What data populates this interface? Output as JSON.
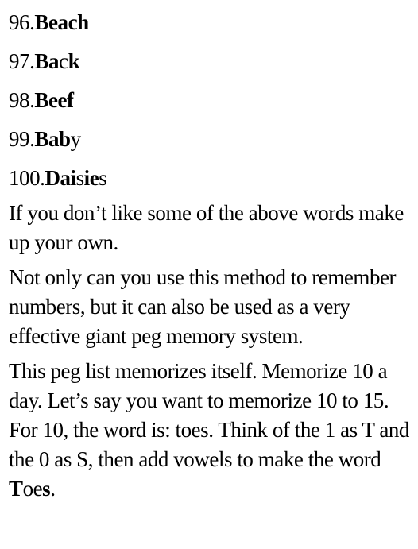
{
  "list": [
    {
      "number": "96.",
      "bold": "Bea",
      "plain": "",
      "bold2": "ch",
      "plain2": ""
    },
    {
      "number": "97.",
      "bold": "Ba",
      "plain": "c",
      "bold2": "k",
      "plain2": ""
    },
    {
      "number": "98.",
      "bold": "Bee",
      "plain": "",
      "bold2": "f",
      "plain2": ""
    },
    {
      "number": "99.",
      "bold": "Ba",
      "plain": "",
      "bold2": "b",
      "plain2": "y"
    },
    {
      "number": "100.",
      "bold": "Dai",
      "plain": "s",
      "bold2": "ie",
      "plain2": "s"
    }
  ],
  "paragraphs": {
    "p1": "If you don’t like some of the above words make up your own.",
    "p2": "Not only can you use this method to remember numbers, but it can also be used as a very effective giant peg memory system.",
    "p3_before": "This peg list memorizes itself. Memorize 10 a day. Let’s say you want to memorize 10 to 15. For 10, the word is: toes. Think of the 1 as T and the 0 as S, then add vowels to make the word ",
    "p3_bold1": "T",
    "p3_mid": "oe",
    "p3_bold2": "s",
    "p3_after": "."
  }
}
